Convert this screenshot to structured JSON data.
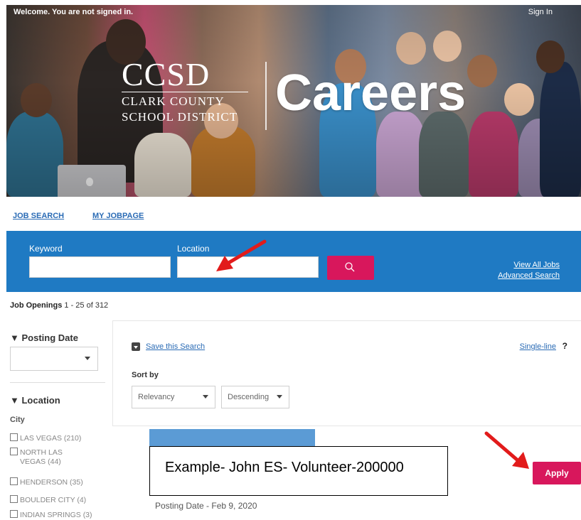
{
  "header": {
    "welcome": "Welcome. You are not signed in.",
    "sign_in": "Sign In",
    "logo_main": "CCSD",
    "logo_line1": "CLARK COUNTY",
    "logo_line2": "SCHOOL DISTRICT",
    "careers": "Careers"
  },
  "nav": {
    "job_search": "JOB SEARCH",
    "my_jobpage": "MY JOBPAGE"
  },
  "search": {
    "keyword_label": "Keyword",
    "keyword_value": "",
    "location_label": "Location",
    "location_value": "",
    "search_icon": "search-icon",
    "view_all_jobs": "View All Jobs",
    "advanced_search": "Advanced Search"
  },
  "results": {
    "label": "Job Openings",
    "range": "1 - 25 of 312"
  },
  "filters": {
    "posting_date_title": "Posting Date",
    "posting_date_value": "",
    "location_title": "Location",
    "city_label": "City",
    "cities": [
      {
        "label": "LAS VEGAS",
        "count": "(210)"
      },
      {
        "label": "NORTH LAS",
        "label2": "VEGAS",
        "count": "(44)"
      },
      {
        "label": "HENDERSON",
        "count": "(35)"
      },
      {
        "label": "BOULDER CITY",
        "count": "(4)"
      },
      {
        "label": "INDIAN SPRINGS",
        "count": "(3)"
      }
    ]
  },
  "panel": {
    "save_search": "Save this Search",
    "single_line": "Single-line",
    "help": "?",
    "sort_by": "Sort by",
    "sort_field": "Relevancy",
    "sort_order": "Descending"
  },
  "job": {
    "example": "Example- John ES- Volunteer-200000",
    "posting_date": "Posting Date - Feb 9, 2020",
    "apply": "Apply"
  },
  "colors": {
    "search_bar": "#1f7ac3",
    "accent": "#d8175c",
    "link": "#2a6bb5",
    "arrow": "#e21b1b"
  }
}
